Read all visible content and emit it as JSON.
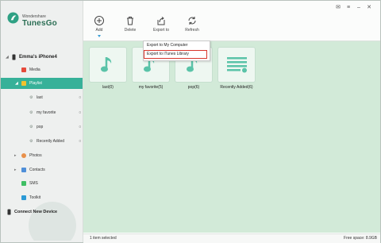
{
  "app": {
    "brand_small": "Wondershare",
    "brand_big": "TunesGo"
  },
  "window_controls": [
    "message-icon",
    "menu-icon",
    "minimize-icon",
    "close-icon"
  ],
  "toolbar": {
    "add_label": "Add",
    "delete_label": "Delete",
    "export_label": "Export to",
    "refresh_label": "Refresh"
  },
  "sidebar": {
    "device": "Emma's iPhone4",
    "media": "Media",
    "playlist": "Playlist",
    "playlists": [
      {
        "label": "last",
        "count": "0"
      },
      {
        "label": "my favorite",
        "count": "0"
      },
      {
        "label": "pop",
        "count": "0"
      },
      {
        "label": "Recently Added",
        "count": "0"
      }
    ],
    "photos": "Photos",
    "contacts": "Contacts",
    "sms": "SMS",
    "toolkit": "Toolkit",
    "connect": "Connect New Device"
  },
  "export_menu": {
    "items": [
      "Export to My Computer",
      "Export to iTunes Library"
    ],
    "highlighted": "Export to iTunes Library"
  },
  "grid": {
    "items": [
      "last(0)",
      "my favorite(5)",
      "pop(6)",
      "Recently Added(6)"
    ]
  },
  "status": {
    "selected": "1 item selected",
    "free_space": "Free space: 8.9GB"
  },
  "colors": {
    "accent": "#37b199",
    "background": "#d2ead8",
    "highlight_border": "#d8362c"
  }
}
